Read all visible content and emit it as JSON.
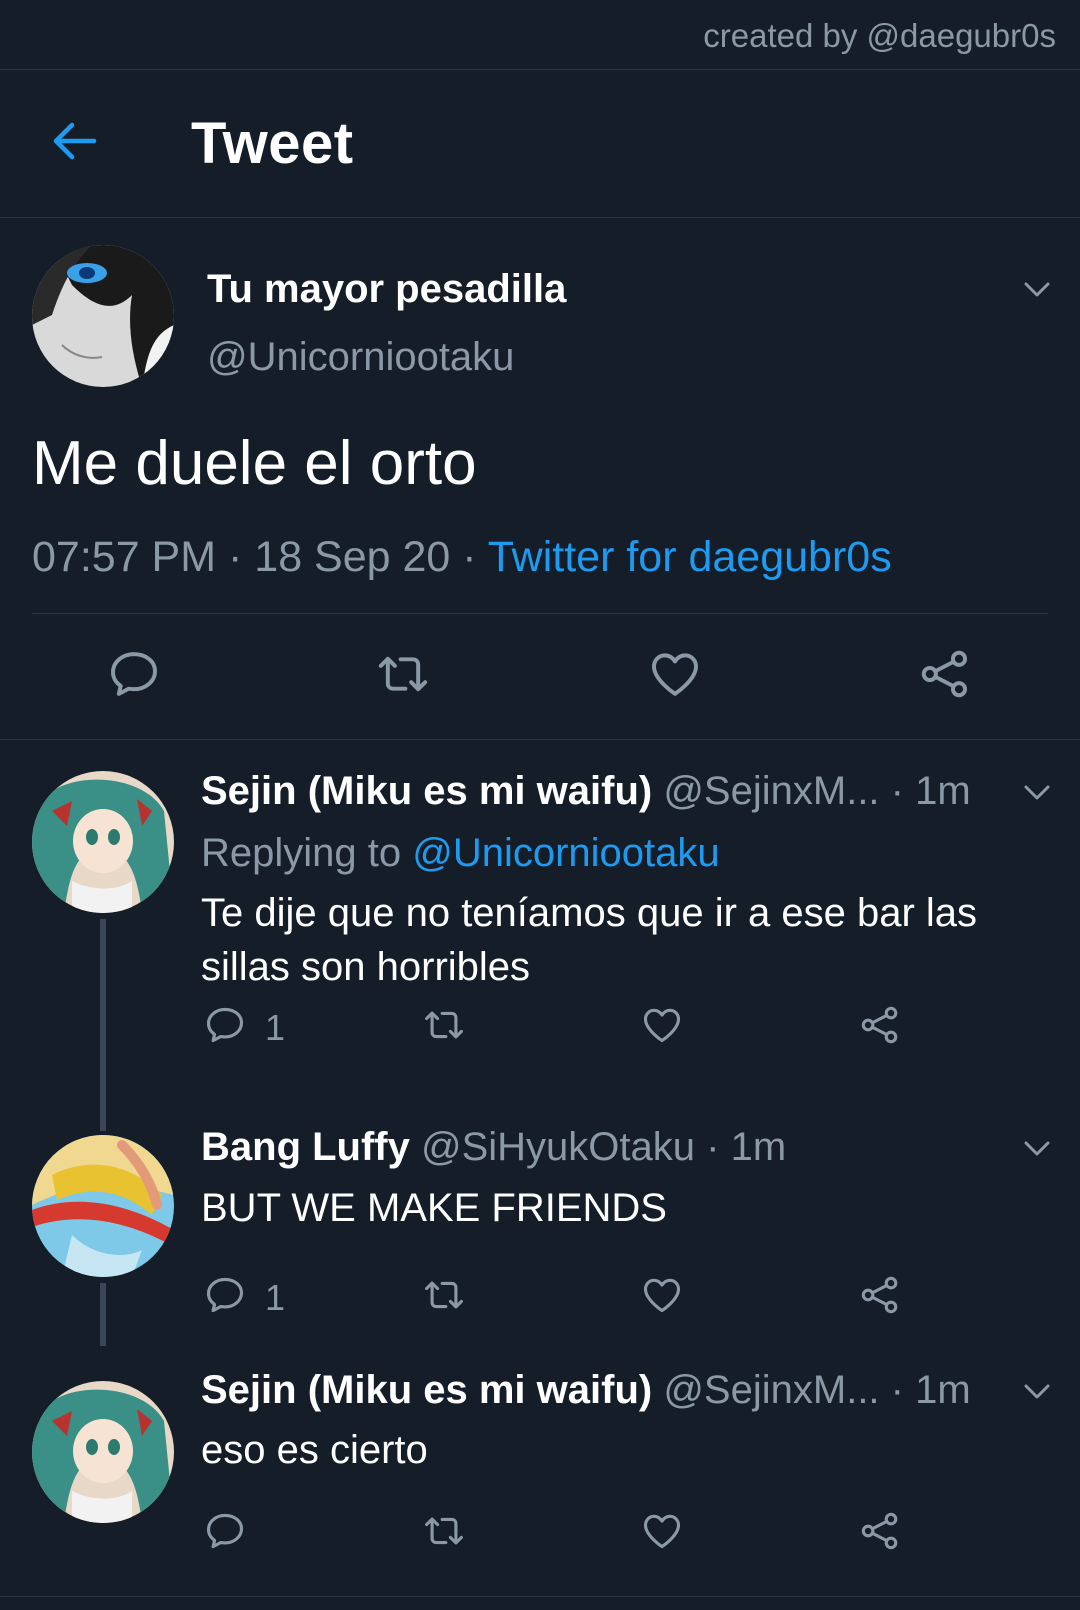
{
  "watermark": "created by @daegubr0s",
  "header": {
    "title": "Tweet",
    "back_icon": "arrow-left-icon"
  },
  "colors": {
    "background": "#151d29",
    "accent": "#1d9bf0",
    "muted": "#8b98a5",
    "divider": "#2c3847"
  },
  "main_tweet": {
    "name": "Tu mayor pesadilla",
    "handle": "@Unicorniootaku",
    "text": "Me duele el orto",
    "time": "07:57 PM",
    "sep1": " · ",
    "date": "18 Sep 20",
    "sep2": " · ",
    "source": "Twitter for daegubr0s",
    "actions": [
      "reply-icon",
      "retweet-icon",
      "like-icon",
      "share-icon"
    ]
  },
  "replies": [
    {
      "name": "Sejin (Miku es mi waifu)",
      "handle": "@SejinxM...",
      "time": " · 1m",
      "replying_prefix": "Replying to ",
      "replying_handle": "@Unicorniootaku",
      "text": "Te dije que no teníamos que ir a ese bar las sillas son horribles",
      "reply_count": "1"
    },
    {
      "name": "Bang Luffy",
      "handle": "@SiHyukOtaku",
      "time": " · 1m",
      "text": "BUT WE MAKE FRIENDS",
      "reply_count": "1"
    },
    {
      "name": "Sejin (Miku es mi waifu)",
      "handle": "@SejinxM...",
      "time": " · 1m",
      "text": "eso es cierto"
    }
  ]
}
